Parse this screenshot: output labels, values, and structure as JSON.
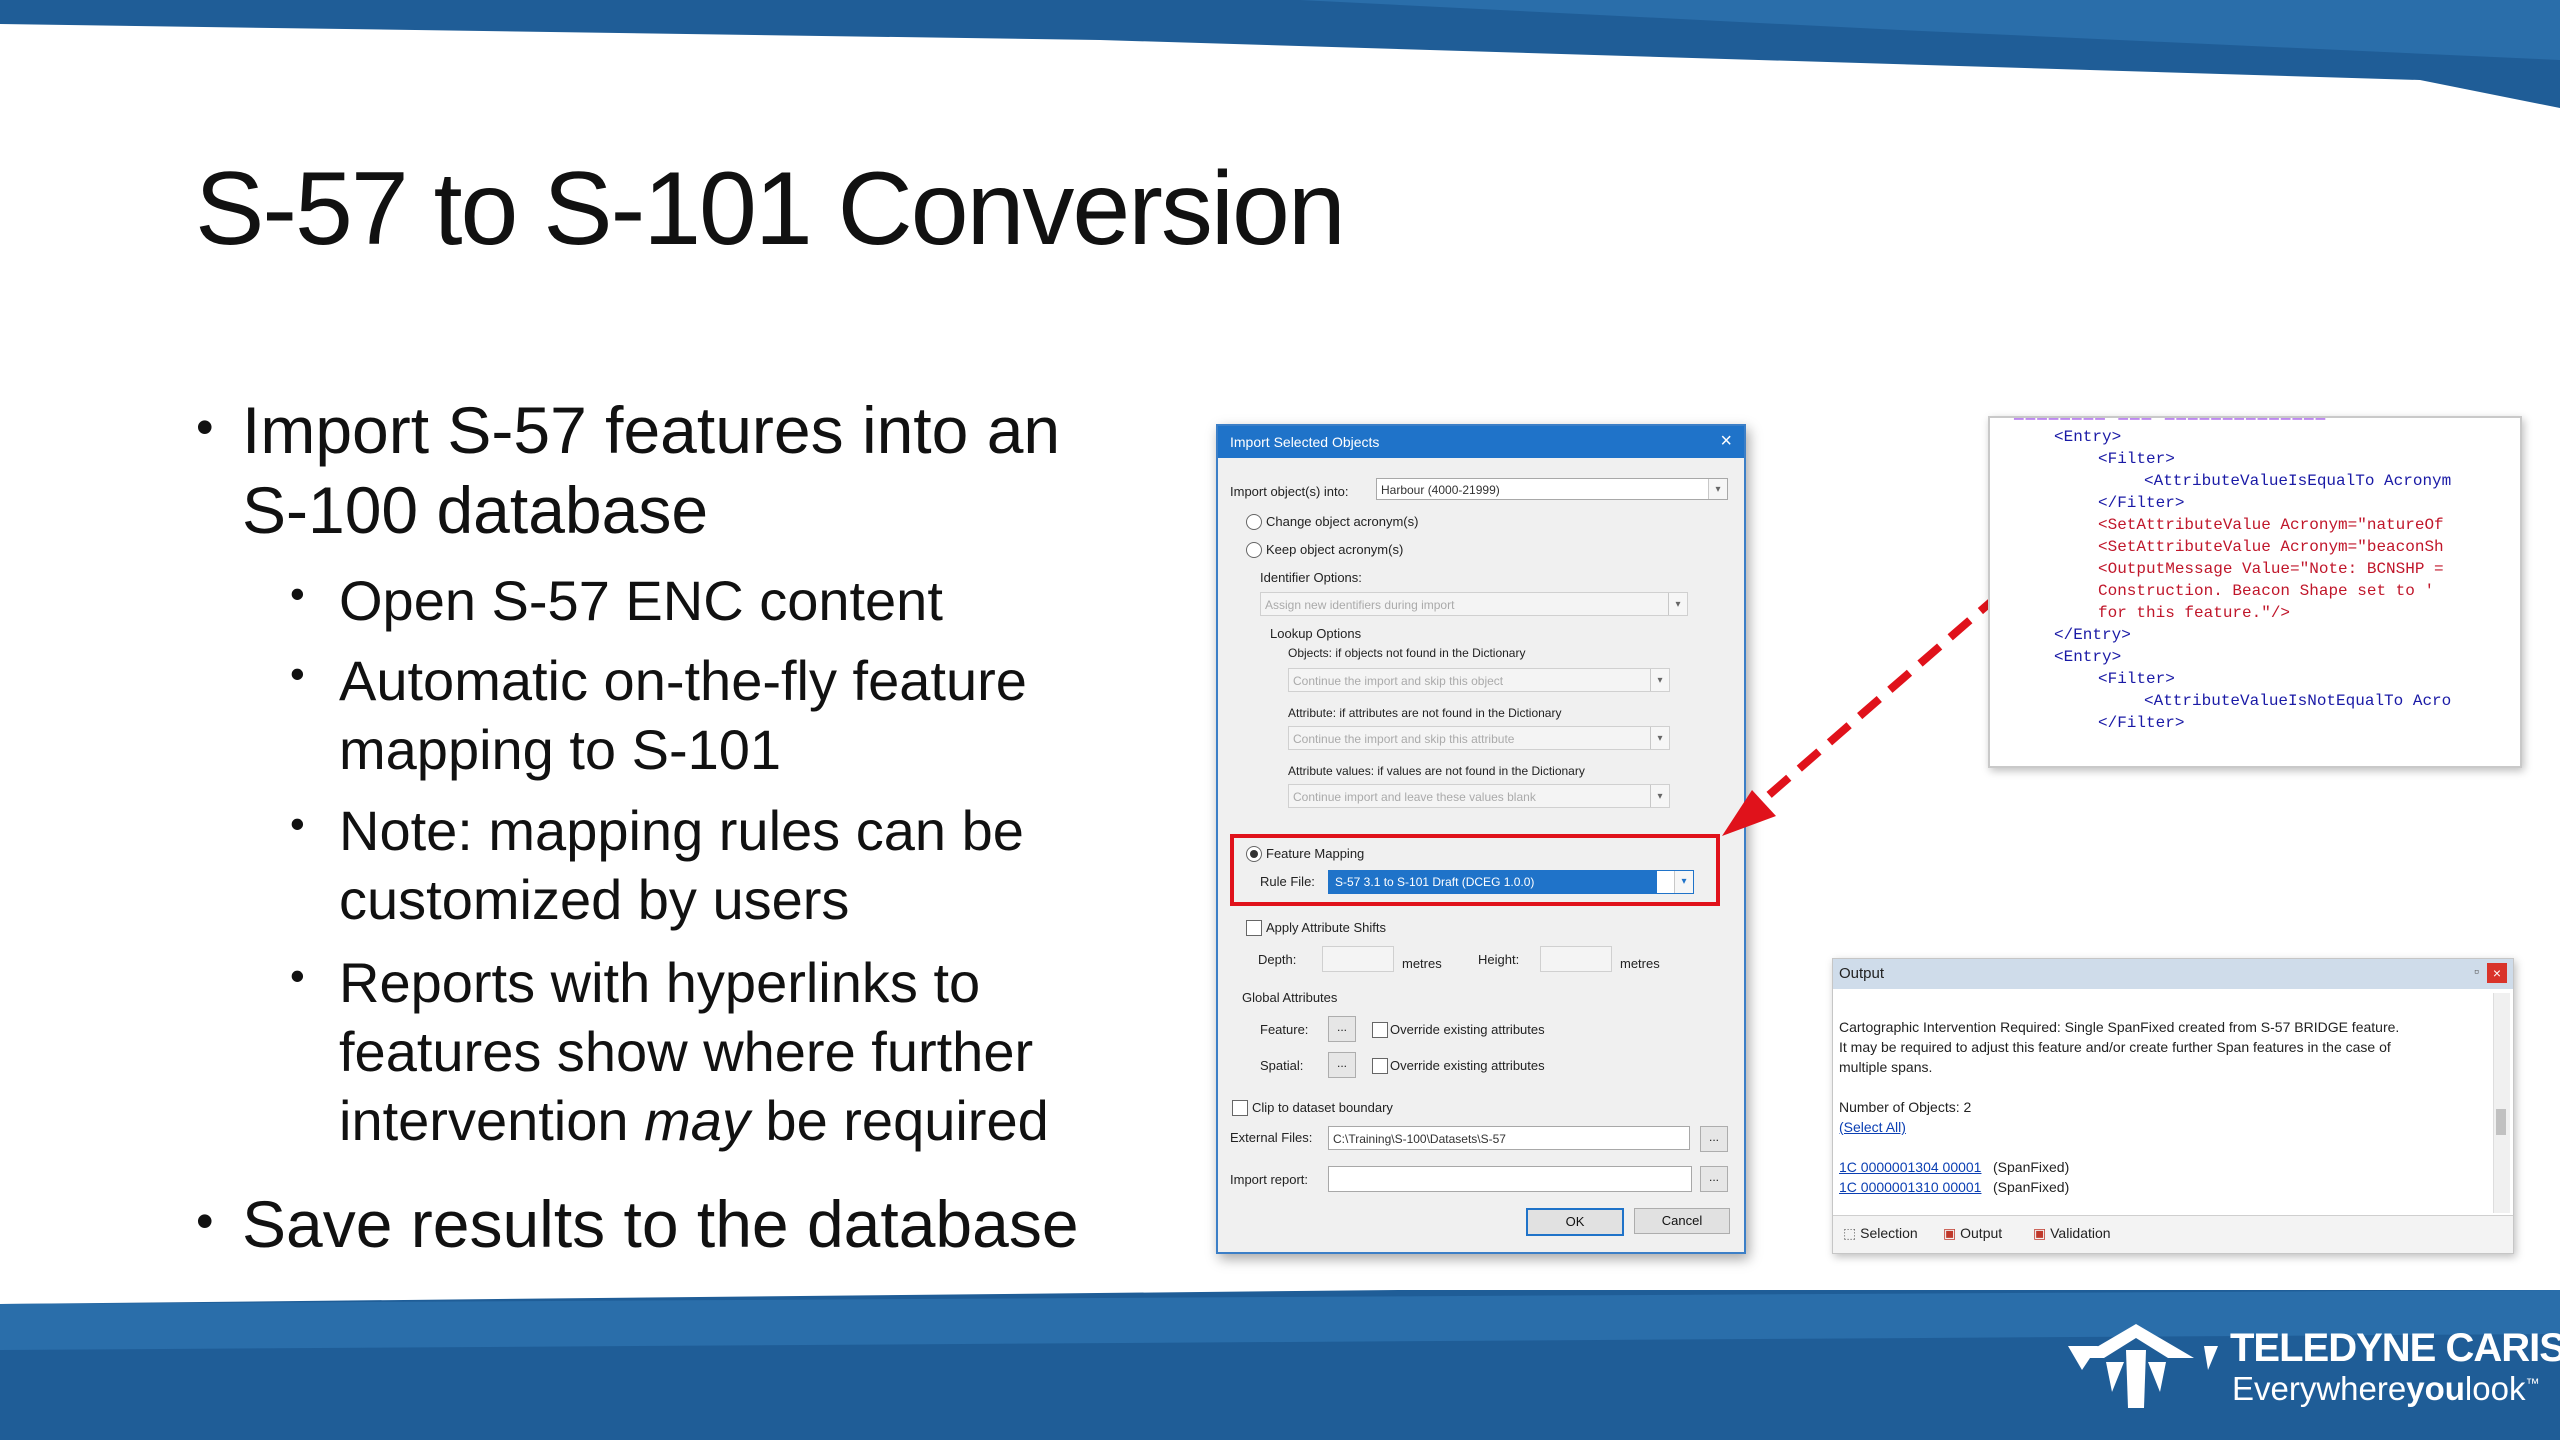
{
  "slide": {
    "title": "S-57 to S-101 Conversion",
    "bullets": [
      {
        "line1": "Import S-57 features into an",
        "line2": "S-100 database"
      },
      {
        "line1": "Save results to the database"
      }
    ],
    "sub_bullets": [
      {
        "lines": [
          "Open S-57 ENC content"
        ]
      },
      {
        "lines": [
          "Automatic on-the-fly feature",
          "mapping to S-101"
        ]
      },
      {
        "lines": [
          "Note: mapping rules can be",
          "customized by users"
        ]
      },
      {
        "line1": "Reports with hyperlinks to",
        "line2": "features show where further",
        "line3_pre": "intervention ",
        "line3_em": "may",
        "line3_post": " be required"
      }
    ],
    "colors": {
      "band": "#1f5d97",
      "highlight": "#e0121b",
      "accent": "#1f73c9"
    }
  },
  "dialog": {
    "title": "Import Selected Objects",
    "close_icon": "×",
    "import_into_label": "Import object(s) into:",
    "import_into_value": "Harbour (4000-21999)",
    "change_acronym": "Change object acronym(s)",
    "keep_acronym": "Keep object acronym(s)",
    "identifier_options": "Identifier Options:",
    "identifier_value": "Assign new identifiers during import",
    "lookup_options": "Lookup Options",
    "objects_label": "Objects: if objects not found in the Dictionary",
    "objects_value": "Continue the import and skip this object",
    "attribute_label": "Attribute: if attributes are not found in the Dictionary",
    "attribute_value": "Continue the import and skip this attribute",
    "attr_values_label": "Attribute values: if values are not found in the Dictionary",
    "attr_values_value": "Continue import and leave these values blank",
    "feature_mapping": "Feature  Mapping",
    "rule_file_label": "Rule File:",
    "rule_file_value": "S-57 3.1 to S-101 Draft (DCEG 1.0.0)",
    "apply_shifts": "Apply Attribute Shifts",
    "depth_label": "Depth:",
    "height_label": "Height:",
    "metres": "metres",
    "global_attributes": "Global Attributes",
    "feature_label": "Feature:",
    "spatial_label": "Spatial:",
    "override": "Override existing attributes",
    "ellipsis": "...",
    "clip": "Clip to dataset boundary",
    "external_files_label": "External Files:",
    "external_files_value": "C:\\Training\\S-100\\Datasets\\S-57",
    "import_report_label": "Import report:",
    "ok": "OK",
    "cancel": "Cancel"
  },
  "xml": {
    "lines": [
      "<Entry>",
      "<Filter>",
      "<AttributeValueIsEqualTo Acronym",
      "</Filter>",
      "<SetAttributeValue Acronym=\"natureOf",
      "<SetAttributeValue Acronym=\"beaconSh",
      "<OutputMessage Value=\"Note: BCNSHP =",
      "Construction.  Beacon Shape set to '",
      "for this feature.\"/>",
      "</Entry>",
      "<Entry>",
      "<Filter>",
      "<AttributeValueIsNotEqualTo Acro",
      "</Filter>"
    ]
  },
  "output": {
    "title": "Output",
    "message_1": "Cartographic Intervention Required: Single SpanFixed created from S-57 BRIDGE feature.",
    "message_2": "It may be required to adjust this feature and/or create further Span features in the case of",
    "message_3": "multiple spans.",
    "count": "Number of Objects: 2",
    "select_all": "(Select All)",
    "obj1_link": "1C 0000001304 00001",
    "obj1_type": "(SpanFixed)",
    "obj2_link": "1C 0000001310 00001",
    "obj2_type": "(SpanFixed)",
    "tabs": [
      "Selection",
      "Output",
      "Validation"
    ]
  },
  "footer": {
    "brand": "TELEDYNE CARIS",
    "tagline_pre": "Everywhere",
    "tagline_bold": "you",
    "tagline_post": "look",
    "tm": "™"
  }
}
